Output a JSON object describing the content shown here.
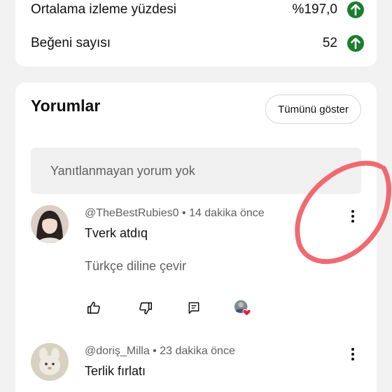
{
  "stats": {
    "rows": [
      {
        "label": "Ortalama izleme yüzdesi",
        "value": "%197,0",
        "trend_icon": "arrow-up-icon"
      },
      {
        "label": "Beğeni sayısı",
        "value": "52",
        "trend_icon": "arrow-up-icon"
      }
    ]
  },
  "comments": {
    "title": "Yorumlar",
    "show_all_label": "Tümünü göster",
    "no_reply_text": "Yanıtlanmayan yorum yok",
    "items": [
      {
        "author": "@TheBestRubies0",
        "time": "14 dakika önce",
        "text": "Tverk atdıq",
        "translate_label": "Türkçe diline çevir"
      },
      {
        "author": "@doriş_Milla",
        "time": "23 dakika önce",
        "text": "Terlik fırlatı"
      }
    ]
  },
  "colors": {
    "trend_up": "#1a7f2d",
    "annotation_circle": "#f05a62",
    "heart": "#e5203a"
  }
}
